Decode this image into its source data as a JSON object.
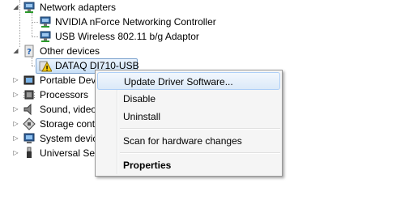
{
  "tree": {
    "network_adapters": "Network adapters",
    "nvidia": "NVIDIA nForce Networking Controller",
    "usb_wireless": "USB Wireless 802.11 b/g Adaptor",
    "other_devices": "Other devices",
    "dataq": "DATAQ DI710-USB",
    "portable": "Portable Devi",
    "processors": "Processors",
    "sound": "Sound, video",
    "storage": "Storage contr",
    "system": "System devic",
    "universal": "Universal Ser"
  },
  "context_menu": {
    "update": "Update Driver Software...",
    "disable": "Disable",
    "uninstall": "Uninstall",
    "scan": "Scan for hardware changes",
    "properties": "Properties"
  },
  "colors": {
    "selection_border": "#7da2ce",
    "menu_bg": "#f5f5f5",
    "warning": "#f2c80f"
  }
}
